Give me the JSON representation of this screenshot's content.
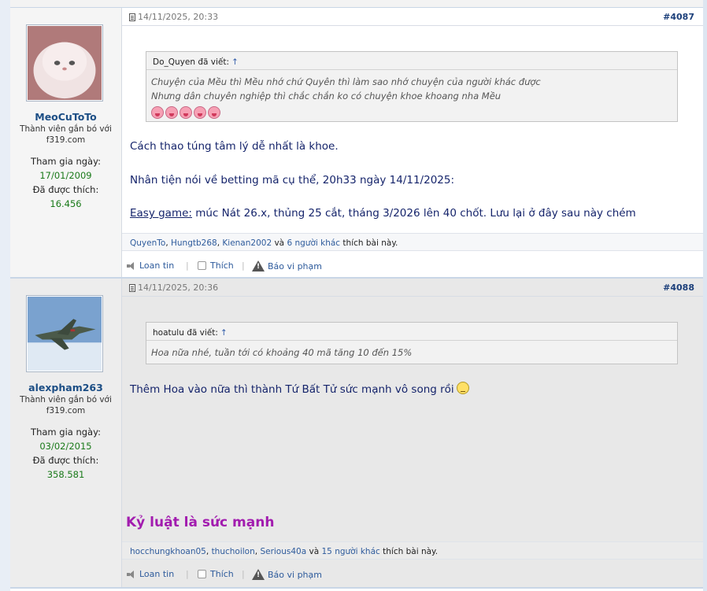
{
  "posts": [
    {
      "date": "14/11/2025, 20:33",
      "number": "#4087",
      "user": {
        "name": "MeoCuToTo",
        "title": "Thành viên gắn bó với f319.com",
        "join_label": "Tham gia ngày:",
        "join_date": "17/01/2009",
        "likes_label": "Đã được thích:",
        "likes_count": "16.456",
        "avatar": "white-persian-cat-avatar"
      },
      "quote": {
        "author": "Do_Quyen đã viết:",
        "arrow": "↑",
        "lines": [
          "Chuyện của Mều thì Mều nhớ chứ Quyên thì làm sao nhớ chuyện của người khác được",
          "Nhưng dân chuyên nghiệp thì chắc chắn ko có chuyện khoe khoang nha Mều"
        ],
        "emoji": "tongue-out-icon"
      },
      "message": {
        "line1": "Cách thao túng tâm lý dễ nhất là khoe.",
        "line2": "Nhân tiện nói về betting mã cụ thể, 20h33 ngày 14/11/2025:",
        "line3_prefix": "Easy game:",
        "line3_rest": " múc Nát 26.x, thủng 25 cắt, tháng 3/2026 lên 40 chốt. Lưu lại ở đây sau này chém"
      },
      "likes": {
        "user1": "QuyenTo",
        "user2": "Hungtb268",
        "user3": "Kienan2002",
        "and": " và ",
        "others": "6 người khác",
        "suffix": " thích bài này."
      },
      "actions": {
        "share": "Loan tin",
        "like": "Thích",
        "report": "Báo vi phạm"
      }
    },
    {
      "date": "14/11/2025, 20:36",
      "number": "#4088",
      "user": {
        "name": "alexpham263",
        "title": "Thành viên gắn bó với f319.com",
        "join_label": "Tham gia ngày:",
        "join_date": "03/02/2015",
        "likes_label": "Đã được thích:",
        "likes_count": "358.581",
        "avatar": "fighter-jet-avatar"
      },
      "quote": {
        "author": "hoatulu đã viết:",
        "arrow": "↑",
        "lines": [
          "Hoa nữa nhé, tuần tới có khoảng 40 mã tăng 10 đến 15%"
        ]
      },
      "message": {
        "line1": "Thêm Hoa vào nữa thì thành Tứ Bất Tử sức mạnh vô song rồi",
        "emoji": "smirk-smiley-icon"
      },
      "signature": "Kỷ luật là sức mạnh",
      "likes": {
        "user1": "hocchungkhoan05",
        "user2": "thuchoilon",
        "user3": "Serious40a",
        "and": " và ",
        "others": "15 người khác",
        "suffix": " thích bài này."
      },
      "actions": {
        "share": "Loan tin",
        "like": "Thích",
        "report": "Báo vi phạm"
      }
    }
  ],
  "colors": {
    "username": "#1c4e85",
    "message_text": "#15246b",
    "signature": "#a21caf",
    "stat_value": "#1a7a1a",
    "link": "#2e5b9c"
  }
}
